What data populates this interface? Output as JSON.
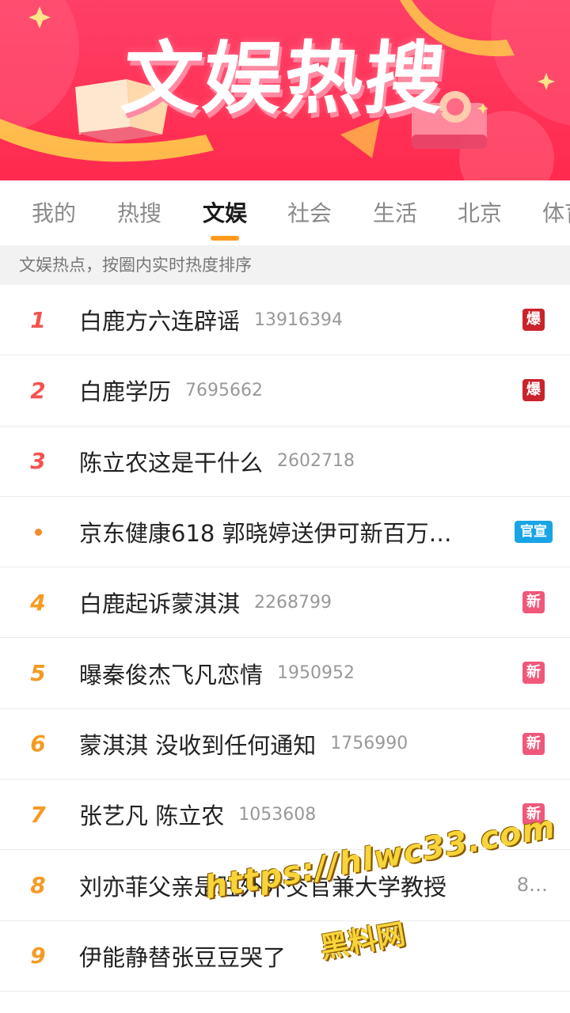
{
  "banner": {
    "title": "文娱热搜",
    "colors": {
      "base": "#ff3358",
      "accent": "#ffd34a"
    }
  },
  "tabs": [
    {
      "label": "我的"
    },
    {
      "label": "热搜"
    },
    {
      "label": "文娱",
      "active": true
    },
    {
      "label": "社会"
    },
    {
      "label": "生活"
    },
    {
      "label": "北京"
    },
    {
      "label": "体育"
    }
  ],
  "hint": "文娱热点，按圈内实时热度排序",
  "list": [
    {
      "rank": "1",
      "title": "白鹿方六连辟谣",
      "count": "13916394",
      "badge": "爆"
    },
    {
      "rank": "2",
      "title": "白鹿学历",
      "count": "7695662",
      "badge": "爆"
    },
    {
      "rank": "3",
      "title": "陈立农这是干什么",
      "count": "2602718",
      "badge": ""
    },
    {
      "rank": "",
      "title": "京东健康618 郭晓婷送伊可新百万…",
      "count": "",
      "badge": "官宣"
    },
    {
      "rank": "4",
      "title": "白鹿起诉蒙淇淇",
      "count": "2268799",
      "badge": "新"
    },
    {
      "rank": "5",
      "title": "曝秦俊杰飞凡恋情",
      "count": "1950952",
      "badge": "新"
    },
    {
      "rank": "6",
      "title": "蒙淇淇 没收到任何通知",
      "count": "1756990",
      "badge": "新"
    },
    {
      "rank": "7",
      "title": "张艺凡 陈立农",
      "count": "1053608",
      "badge": "新"
    },
    {
      "rank": "8",
      "title": "刘亦菲父亲是驻外外交官兼大学教授",
      "count": "8…",
      "badge": ""
    },
    {
      "rank": "9",
      "title": "伊能静替张豆豆哭了",
      "count": "",
      "badge": ""
    }
  ],
  "watermark": {
    "url": "https://hlwc33.com",
    "name": "黑料网"
  }
}
